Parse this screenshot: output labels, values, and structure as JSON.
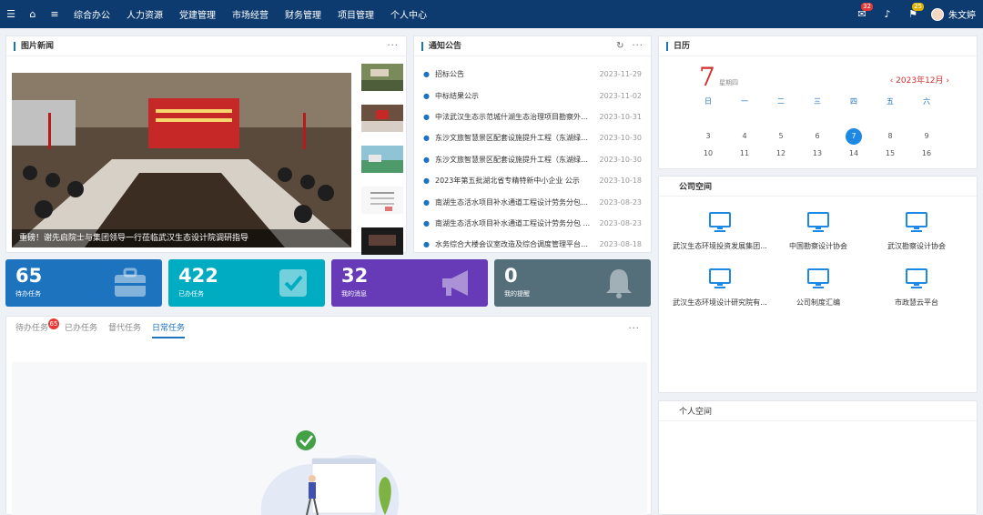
{
  "nav": {
    "items": [
      "综合办公",
      "人力资源",
      "党建管理",
      "市场经营",
      "财务管理",
      "项目管理",
      "个人中心"
    ],
    "message_badge": "32",
    "flag_badge": "25",
    "user_name": "朱文婷"
  },
  "news": {
    "title": "图片新闻",
    "more": "···",
    "caption": "重磅！谢先启院士与集团领导一行莅临武汉生态设计院调研指导"
  },
  "notices": {
    "title": "通知公告",
    "more": "···",
    "items": [
      {
        "title": "招标公告",
        "date": "2023-11-29"
      },
      {
        "title": "中标结果公示",
        "date": "2023-11-02"
      },
      {
        "title": "中法武汉生态示范城什湖生态治理项目勘察外业...",
        "date": "2023-10-31"
      },
      {
        "title": "东沙文旅智慧景区配套设施提升工程（东湖绿道...",
        "date": "2023-10-30"
      },
      {
        "title": "东沙文旅智慧景区配套设施提升工程（东湖绿道...",
        "date": "2023-10-30"
      },
      {
        "title": "2023年第五批湖北省专精特新中小企业 公示",
        "date": "2023-10-18"
      },
      {
        "title": "南湖生态活水项目补水通道工程设计劳务分包服...",
        "date": "2023-08-23"
      },
      {
        "title": "南湖生态活水项目补水通道工程设计劳务分包 ...",
        "date": "2023-08-23"
      },
      {
        "title": "水务综合大楼会议室改造及综合调度管理平台建...",
        "date": "2023-08-18"
      }
    ]
  },
  "calendar": {
    "title": "日历",
    "day": "7",
    "weekday": "星期四",
    "month_label": "‹  2023年12月  ›",
    "headers": [
      "日",
      "一",
      "二",
      "三",
      "四",
      "五",
      "六"
    ],
    "rows": [
      [
        "3",
        "4",
        "5",
        "6",
        "7",
        "8",
        "9"
      ],
      [
        "10",
        "11",
        "12",
        "13",
        "14",
        "15",
        "16"
      ]
    ]
  },
  "stats": [
    {
      "value": "65",
      "label": "待办任务",
      "color": "#1e73be"
    },
    {
      "value": "422",
      "label": "已办任务",
      "color": "#00acc1"
    },
    {
      "value": "32",
      "label": "我的消息",
      "color": "#673ab7"
    },
    {
      "value": "0",
      "label": "我的提醒",
      "color": "#546e7a"
    }
  ],
  "company_space": {
    "title": "公司空间",
    "items": [
      "武汉生态环境投资发展集团...",
      "中国勘察设计协会",
      "武汉勘察设计协会",
      "武汉生态环境设计研究院有...",
      "公司制度汇编",
      "市政慧云平台"
    ]
  },
  "personal_space": {
    "title": "个人空间"
  },
  "tasks": {
    "tabs": [
      "待办任务",
      "已办任务",
      "督代任务",
      "日常任务"
    ],
    "badge": "65",
    "more": "···"
  }
}
